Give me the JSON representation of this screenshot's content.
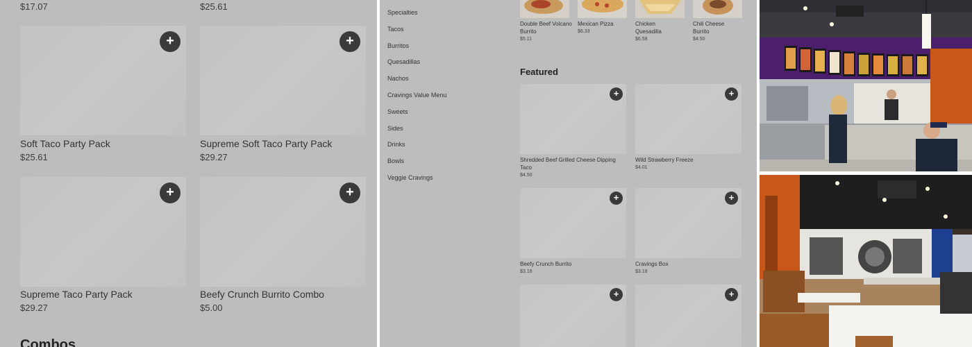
{
  "left_panel": {
    "top_prices": [
      "$17.07",
      "$25.61"
    ],
    "items": [
      {
        "name": "Soft Taco Party Pack",
        "price": "$25.61"
      },
      {
        "name": "Supreme Soft Taco Party Pack",
        "price": "$29.27"
      },
      {
        "name": "Supreme Taco Party Pack",
        "price": "$29.27"
      },
      {
        "name": "Beefy Crunch Burrito Combo",
        "price": "$5.00"
      }
    ],
    "add_symbol": "+",
    "next_section": "Combos"
  },
  "middle_panel": {
    "nav": [
      "Specialties",
      "Tacos",
      "Burritos",
      "Quesadillas",
      "Nachos",
      "Cravings Value Menu",
      "Sweets",
      "Sides",
      "Drinks",
      "Bowls",
      "Veggie Cravings"
    ],
    "top_items": [
      {
        "name": "Double Beef Volcano Burrito",
        "price": "$5.11"
      },
      {
        "name": "Mexican Pizza",
        "price": "$6.33"
      },
      {
        "name": "Chicken Quesadilla",
        "price": "$6.58"
      },
      {
        "name": "Chili Cheese Burrito",
        "price": "$4.50"
      }
    ],
    "featured_title": "Featured",
    "featured": [
      {
        "name": "Shredded Beef Grilled Cheese Dipping Taco",
        "price": "$4.50"
      },
      {
        "name": "Wild Strawberry Freeze",
        "price": "$4.01"
      },
      {
        "name": "Beefy Crunch Burrito",
        "price": "$3.16"
      },
      {
        "name": "Cravings Box",
        "price": "$3.18"
      }
    ],
    "add_symbol": "+"
  },
  "photos": {
    "colors": {
      "purple_wall": "#4b1f6b",
      "orange_wall": "#c8581a",
      "ceiling": "#1e1e1e",
      "blue_wall": "#1e3f8f"
    }
  }
}
